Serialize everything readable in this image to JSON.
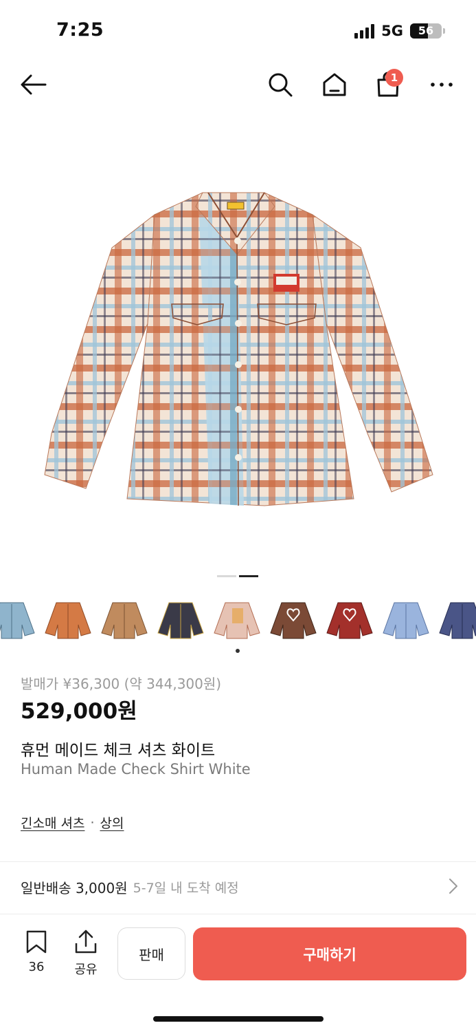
{
  "status_bar": {
    "time": "7:25",
    "network": "5G",
    "battery": "56",
    "battery_level": 0.56
  },
  "nav": {
    "cart_count": "1"
  },
  "gallery": {
    "current_page": 2,
    "page_count": 2
  },
  "thumbnails": [
    {
      "name": "light blue check"
    },
    {
      "name": "orange check"
    },
    {
      "name": "brown check"
    },
    {
      "name": "navy yellow check"
    },
    {
      "name": "white check",
      "selected": true
    },
    {
      "name": "brown heart check"
    },
    {
      "name": "red heart check"
    },
    {
      "name": "blue stripe"
    },
    {
      "name": "navy"
    }
  ],
  "product": {
    "release_price": "발매가 ¥36,300 (약 344,300원)",
    "price": "529,000원",
    "name_ko": "휴먼 메이드 체크 셔츠 화이트",
    "name_en": "Human Made Check Shirt White",
    "category_1": "긴소매 셔츠",
    "category_sep": "·",
    "category_2": "상의"
  },
  "shipping": {
    "label": "일반배송 3,000원",
    "eta": "5-7일 내 도착 예정"
  },
  "bottom_bar": {
    "bookmark_count": "36",
    "share_label": "공유",
    "sell_label": "판매",
    "buy_label": "구매하기"
  },
  "colors": {
    "accent": "#ef5c50",
    "text": "#222222",
    "muted": "#9a9a9a"
  }
}
